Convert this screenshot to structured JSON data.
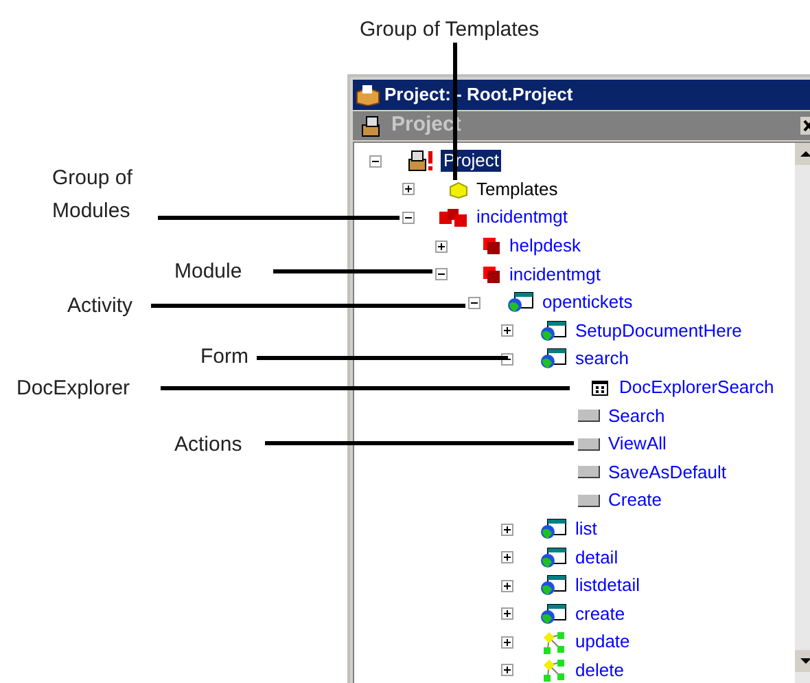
{
  "callouts": [
    {
      "kind": "top",
      "label": "Group of Templates"
    },
    {
      "kind": "left",
      "label": "Group of Modules"
    },
    {
      "kind": "left",
      "label": "Module"
    },
    {
      "kind": "left",
      "label": "Activity"
    },
    {
      "kind": "left",
      "label": "Form"
    },
    {
      "kind": "left",
      "label": "DocExplorer"
    },
    {
      "kind": "left",
      "label": "Actions"
    }
  ],
  "window": {
    "title": "Project: - Root.Project",
    "pane_title": "Project"
  },
  "tree": [
    {
      "label": "Project",
      "kind": "project",
      "selected": true,
      "expanded": true,
      "children": [
        {
          "label": "Templates",
          "kind": "templates",
          "selected": false,
          "expanded": false
        },
        {
          "label": "incidentmgt",
          "kind": "module-group",
          "selected": false,
          "expanded": true,
          "children": [
            {
              "label": "helpdesk",
              "kind": "module",
              "selected": false,
              "expanded": false
            },
            {
              "label": "incidentmgt",
              "kind": "module",
              "selected": false,
              "expanded": true,
              "children": [
                {
                  "label": "opentickets",
                  "kind": "activity",
                  "selected": false,
                  "expanded": true,
                  "children": [
                    {
                      "label": "SetupDocumentHere",
                      "kind": "form",
                      "selected": false,
                      "expanded": false
                    },
                    {
                      "label": "search",
                      "kind": "form",
                      "selected": false,
                      "expanded": true,
                      "children": [
                        {
                          "label": "DocExplorerSearch",
                          "kind": "docexplorer",
                          "selected": false
                        },
                        {
                          "label": "Search",
                          "kind": "action",
                          "selected": false
                        },
                        {
                          "label": "ViewAll",
                          "kind": "action",
                          "selected": false
                        },
                        {
                          "label": "SaveAsDefault",
                          "kind": "action",
                          "selected": false
                        },
                        {
                          "label": "Create",
                          "kind": "action",
                          "selected": false
                        }
                      ]
                    },
                    {
                      "label": "list",
                      "kind": "form",
                      "selected": false,
                      "expanded": false
                    },
                    {
                      "label": "detail",
                      "kind": "form",
                      "selected": false,
                      "expanded": false
                    },
                    {
                      "label": "listdetail",
                      "kind": "form",
                      "selected": false,
                      "expanded": false
                    },
                    {
                      "label": "create",
                      "kind": "form",
                      "selected": false,
                      "expanded": false
                    },
                    {
                      "label": "update",
                      "kind": "flow",
                      "selected": false,
                      "expanded": false
                    },
                    {
                      "label": "delete",
                      "kind": "flow",
                      "selected": false,
                      "expanded": false
                    }
                  ]
                }
              ]
            }
          ]
        }
      ]
    }
  ]
}
